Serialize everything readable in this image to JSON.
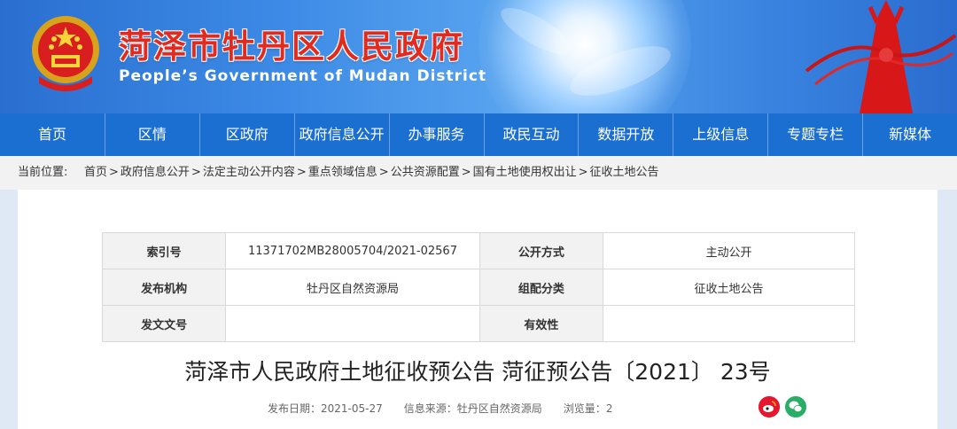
{
  "header": {
    "title_cn": "菏泽市牡丹区人民政府",
    "title_en": "People’s Government of Mudan District"
  },
  "nav": [
    "首页",
    "区情",
    "区政府",
    "政府信息公开",
    "办事服务",
    "政民互动",
    "数据开放",
    "上级信息",
    "专题专栏",
    "新媒体"
  ],
  "breadcrumb": {
    "label": "当前位置:",
    "items": [
      "首页",
      "政府信息公开",
      "法定主动公开内容",
      "重点领域信息",
      "公共资源配置",
      "国有土地使用权出让",
      "征收土地公告"
    ]
  },
  "meta": {
    "row1": {
      "k1": "索引号",
      "v1": "11371702MB28005704/2021-02567",
      "k2": "公开方式",
      "v2": "主动公开"
    },
    "row2": {
      "k1": "发布机构",
      "v1": "牡丹区自然资源局",
      "k2": "组配分类",
      "v2": "征收土地公告"
    },
    "row3": {
      "k1": "发文文号",
      "v1": "",
      "k2": "有效性",
      "v2": ""
    }
  },
  "article": {
    "title": "菏泽市人民政府土地征收预公告 菏征预公告〔2021〕 23号",
    "date_label": "发布日期：",
    "date": "2021-05-27",
    "source_label": "信息来源：",
    "source": "牡丹区自然资源局",
    "views_label": "浏览量：",
    "views": "2"
  },
  "icons": {
    "weibo": "weibo-icon",
    "wechat": "wechat-icon"
  },
  "colors": {
    "nav": "#1b6fd1",
    "title_red": "#e32a1e"
  }
}
